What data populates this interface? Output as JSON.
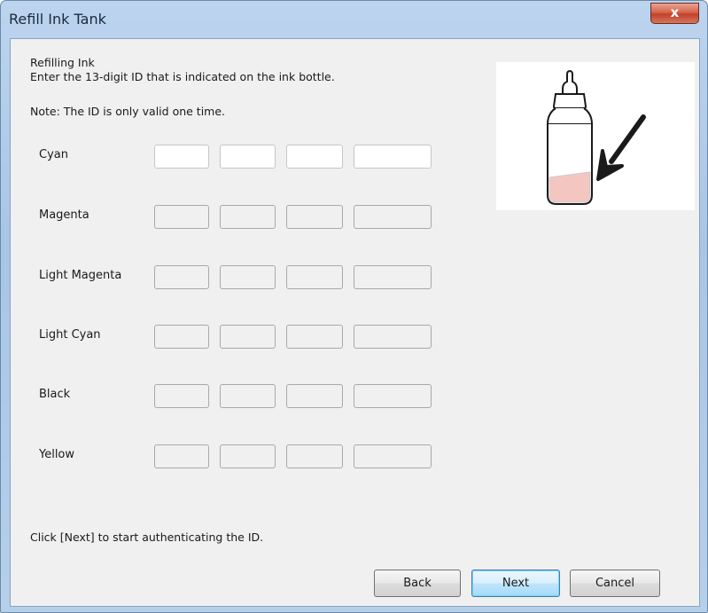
{
  "window": {
    "title": "Refill Ink Tank",
    "close_symbol": "x"
  },
  "content": {
    "heading": "Refilling Ink",
    "instruction": "Enter the 13-digit ID that is indicated on the ink bottle.",
    "note": "Note: The ID is only valid one time.",
    "footer": "Click [Next] to start authenticating the ID."
  },
  "colors": [
    {
      "label": "Cyan",
      "active": true
    },
    {
      "label": "Magenta",
      "active": false
    },
    {
      "label": "Light Magenta",
      "active": false
    },
    {
      "label": "Light Cyan",
      "active": false
    },
    {
      "label": "Black",
      "active": false
    },
    {
      "label": "Yellow",
      "active": false
    }
  ],
  "buttons": {
    "back": "Back",
    "next": "Next",
    "cancel": "Cancel"
  },
  "illustration": {
    "name": "ink-bottle-with-arrow",
    "ink_color": "#f4c6c2",
    "arrow_color": "#1a1a1a"
  }
}
